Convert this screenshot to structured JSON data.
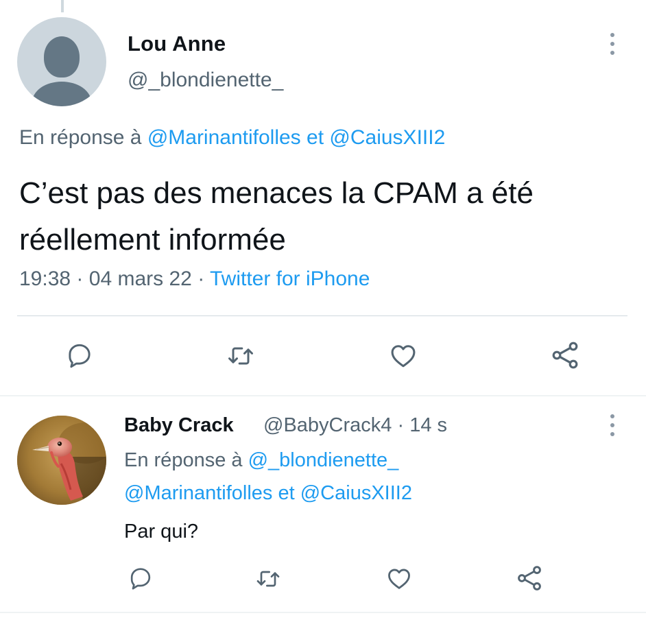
{
  "main_tweet": {
    "author_name": "Lou Anne",
    "author_handle": "@_blondienette_",
    "reply_prefix": "En réponse à",
    "reply_mention_1": "@Marinantifolles",
    "reply_conjunction": "et",
    "reply_mention_2": "@CaiusXIII2",
    "text": "C’est pas des menaces la CPAM a été réellement informée",
    "time": "19:38",
    "date": "04 mars 22",
    "separator": "·",
    "source": "Twitter for iPhone"
  },
  "reply_tweet": {
    "author_name": "Baby Crack",
    "author_handle": "@BabyCrack4",
    "separator": "·",
    "age": "14 s",
    "reply_prefix": "En réponse à",
    "reply_mention_1": "@_blondienette_",
    "reply_mention_2": "@Marinantifolles",
    "reply_conjunction": "et",
    "reply_mention_3": "@CaiusXIII2",
    "text": "Par qui?"
  },
  "icons": {
    "reply": "reply-icon",
    "retweet": "retweet-icon",
    "like": "heart-icon",
    "share": "share-icon",
    "more": "more-options-icon"
  },
  "colors": {
    "link": "#1d9bf0",
    "secondary_text": "#536471",
    "primary_text": "#0f1419",
    "divider": "#cfd9de"
  }
}
